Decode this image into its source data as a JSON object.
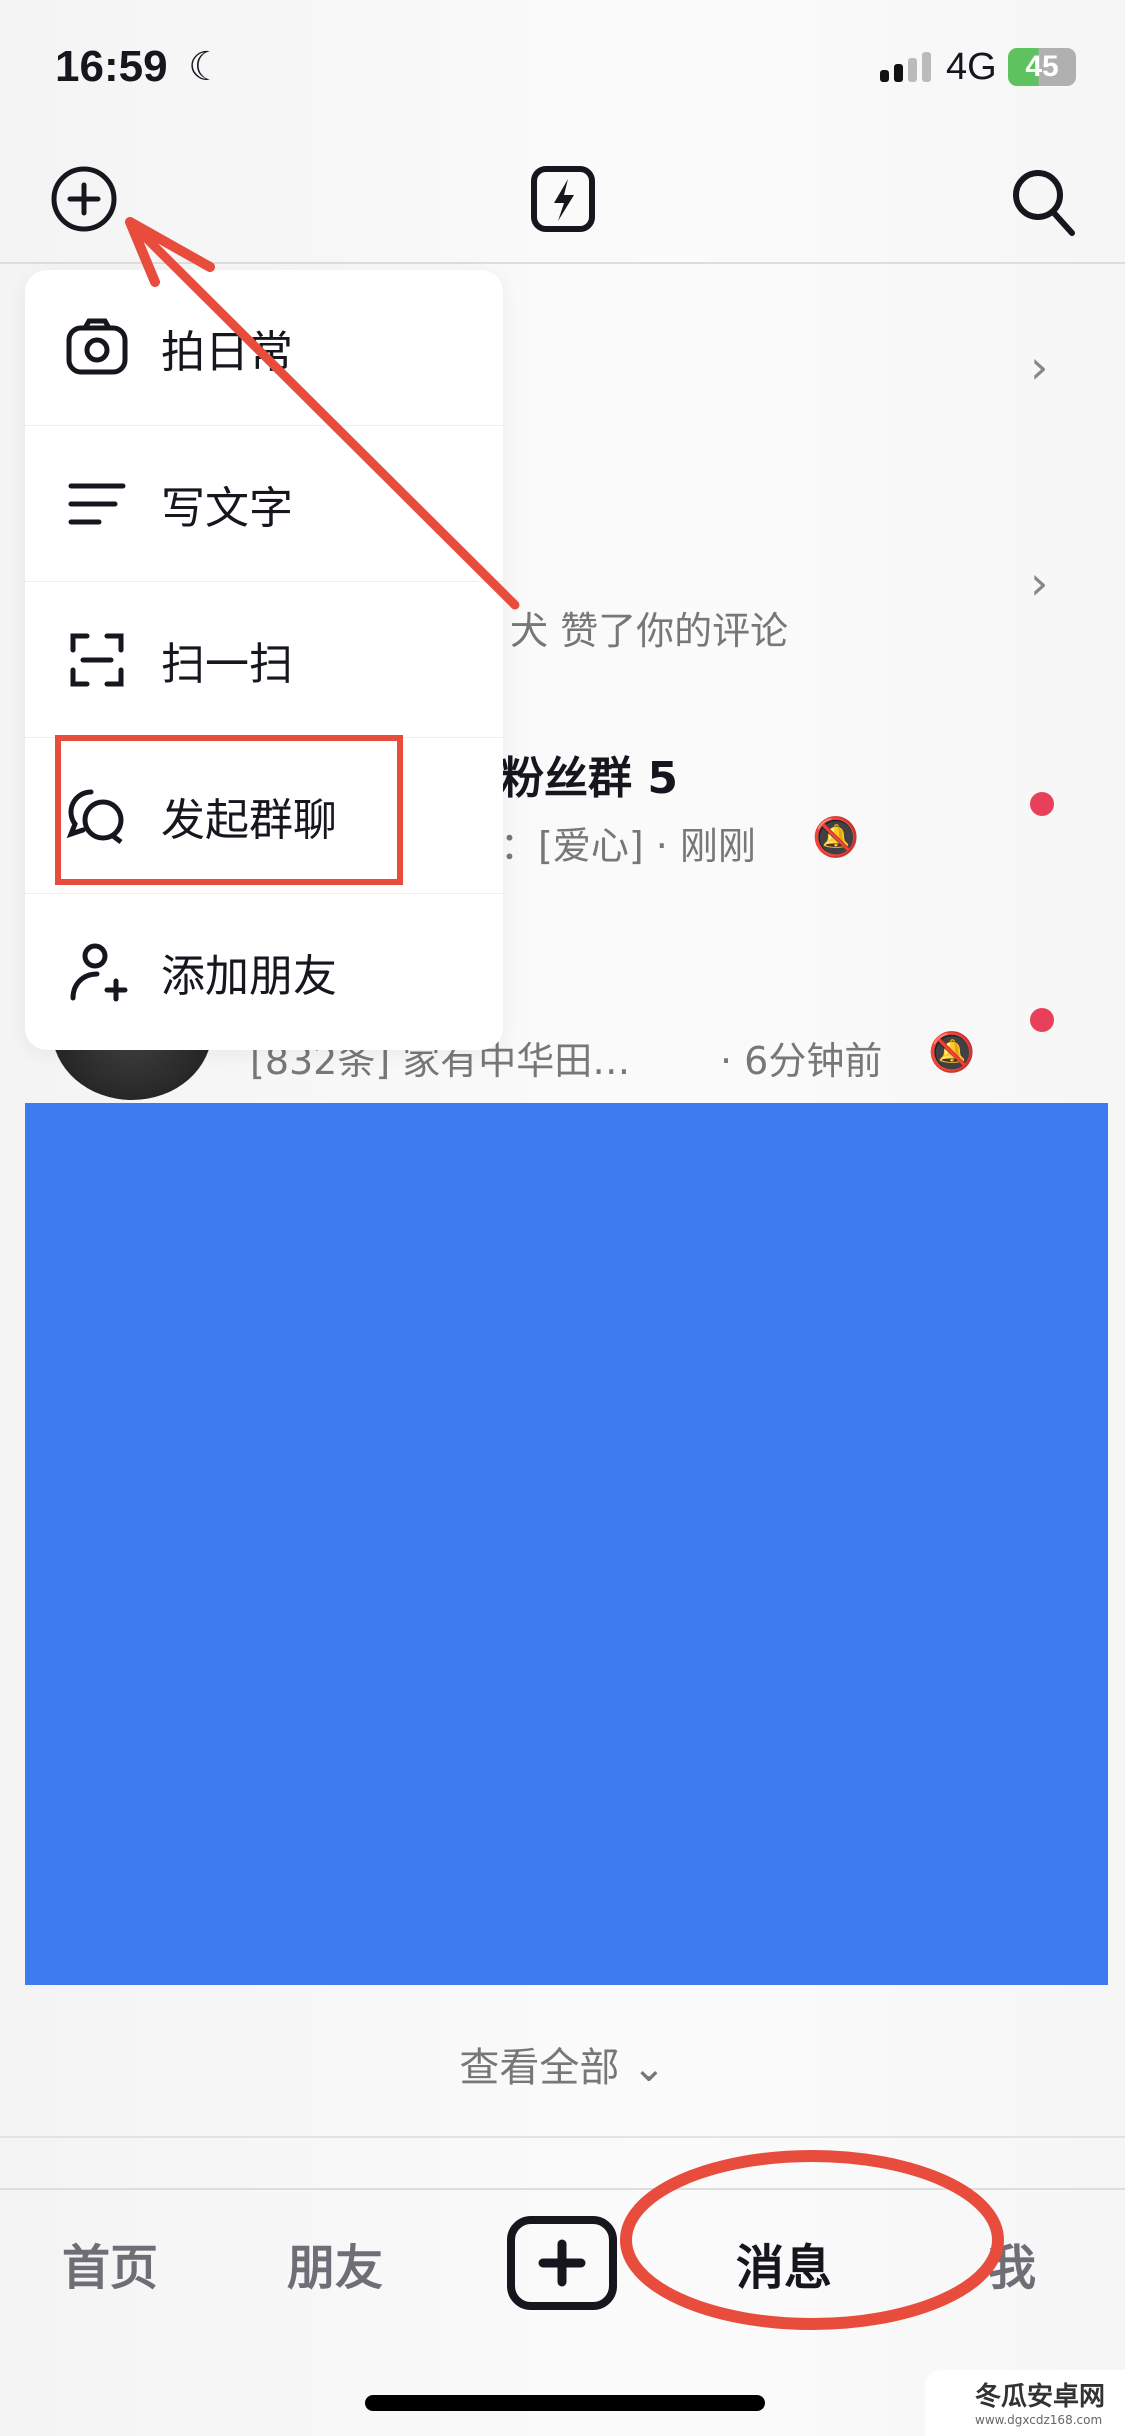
{
  "status_bar": {
    "time": "16:59",
    "network": "4G",
    "battery": "45"
  },
  "header": {
    "icons": [
      "add-circle-icon",
      "flash-icon",
      "search-icon"
    ]
  },
  "menu": {
    "items": [
      {
        "label": "拍日常",
        "icon": "camera-icon"
      },
      {
        "label": "写文字",
        "icon": "text-lines-icon"
      },
      {
        "label": "扫一扫",
        "icon": "scan-icon"
      },
      {
        "label": "发起群聊",
        "icon": "group-chat-icon"
      },
      {
        "label": "添加朋友",
        "icon": "add-friend-icon"
      }
    ]
  },
  "list": {
    "notice_text": "犬 赞了你的评论",
    "group_title": "粉丝群 5",
    "group_sub": "：[爱心] · 刚刚",
    "chat_sub": "[832条] 家有中华田…",
    "chat_time": "· 6分钟前"
  },
  "view_all": "查看全部",
  "tabs": [
    {
      "label": "首页"
    },
    {
      "label": "朋友"
    },
    {
      "label": "消息",
      "active": true
    },
    {
      "label": "我"
    }
  ],
  "colors": {
    "accent_blue": "#3c7cf0",
    "annotation_red": "#e84c3d",
    "unread_dot": "#e8405a"
  },
  "watermark": {
    "name": "冬瓜安卓网",
    "url": "www.dgxcdz168.com"
  }
}
